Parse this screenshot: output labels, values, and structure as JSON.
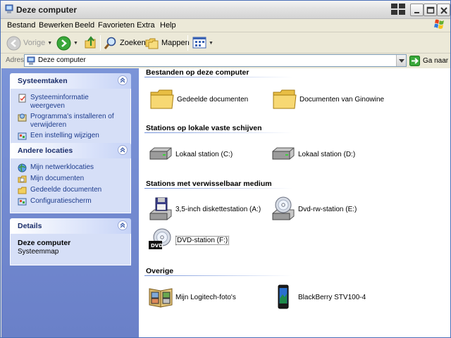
{
  "window": {
    "title": "Deze computer"
  },
  "menu": {
    "items": [
      "Bestand",
      "Bewerken",
      "Beeld",
      "Favorieten",
      "Extra",
      "Help"
    ]
  },
  "toolbar": {
    "back_label": "Vorige",
    "search_label": "Zoeken",
    "folders_label": "Mappen"
  },
  "address": {
    "label": "Adres",
    "value": "Deze computer",
    "go_label": "Ga naar"
  },
  "sidebar": {
    "system_tasks": {
      "title": "Systeemtaken",
      "items": [
        {
          "label": "Systeeminformatie weergeven",
          "icon": "system-info-icon"
        },
        {
          "label": "Programma's installeren of verwijderen",
          "icon": "add-remove-programs-icon"
        },
        {
          "label": "Een instelling wijzigen",
          "icon": "control-panel-icon"
        }
      ]
    },
    "other_places": {
      "title": "Andere locaties",
      "items": [
        {
          "label": "Mijn netwerklocaties",
          "icon": "network-places-icon"
        },
        {
          "label": "Mijn documenten",
          "icon": "my-documents-icon"
        },
        {
          "label": "Gedeelde documenten",
          "icon": "shared-documents-icon"
        },
        {
          "label": "Configuratiescherm",
          "icon": "control-panel-icon"
        }
      ]
    },
    "details": {
      "title": "Details",
      "name": "Deze computer",
      "subtitle": "Systeemmap"
    }
  },
  "main": {
    "groups": [
      {
        "title": "Bestanden op deze computer",
        "items": [
          {
            "label": "Gedeelde documenten",
            "icon": "folder-icon"
          },
          {
            "label": "Documenten van Ginowine",
            "icon": "folder-icon"
          }
        ]
      },
      {
        "title": "Stations op lokale vaste schijven",
        "items": [
          {
            "label": "Lokaal station (C:)",
            "icon": "hard-drive-icon"
          },
          {
            "label": "Lokaal station (D:)",
            "icon": "hard-drive-icon"
          }
        ]
      },
      {
        "title": "Stations met verwisselbaar medium",
        "items": [
          {
            "label": "3,5-inch diskettestation (A:)",
            "icon": "floppy-drive-icon"
          },
          {
            "label": "Dvd-rw-station (E:)",
            "icon": "dvd-rw-drive-icon"
          },
          {
            "label": "DVD-station (F:)",
            "icon": "dvd-drive-icon",
            "selected": true
          }
        ]
      },
      {
        "title": "Overige",
        "items": [
          {
            "label": "Mijn Logitech-foto's",
            "icon": "photo-album-icon"
          },
          {
            "label": "BlackBerry STV100-4",
            "icon": "phone-icon"
          }
        ]
      }
    ]
  }
}
